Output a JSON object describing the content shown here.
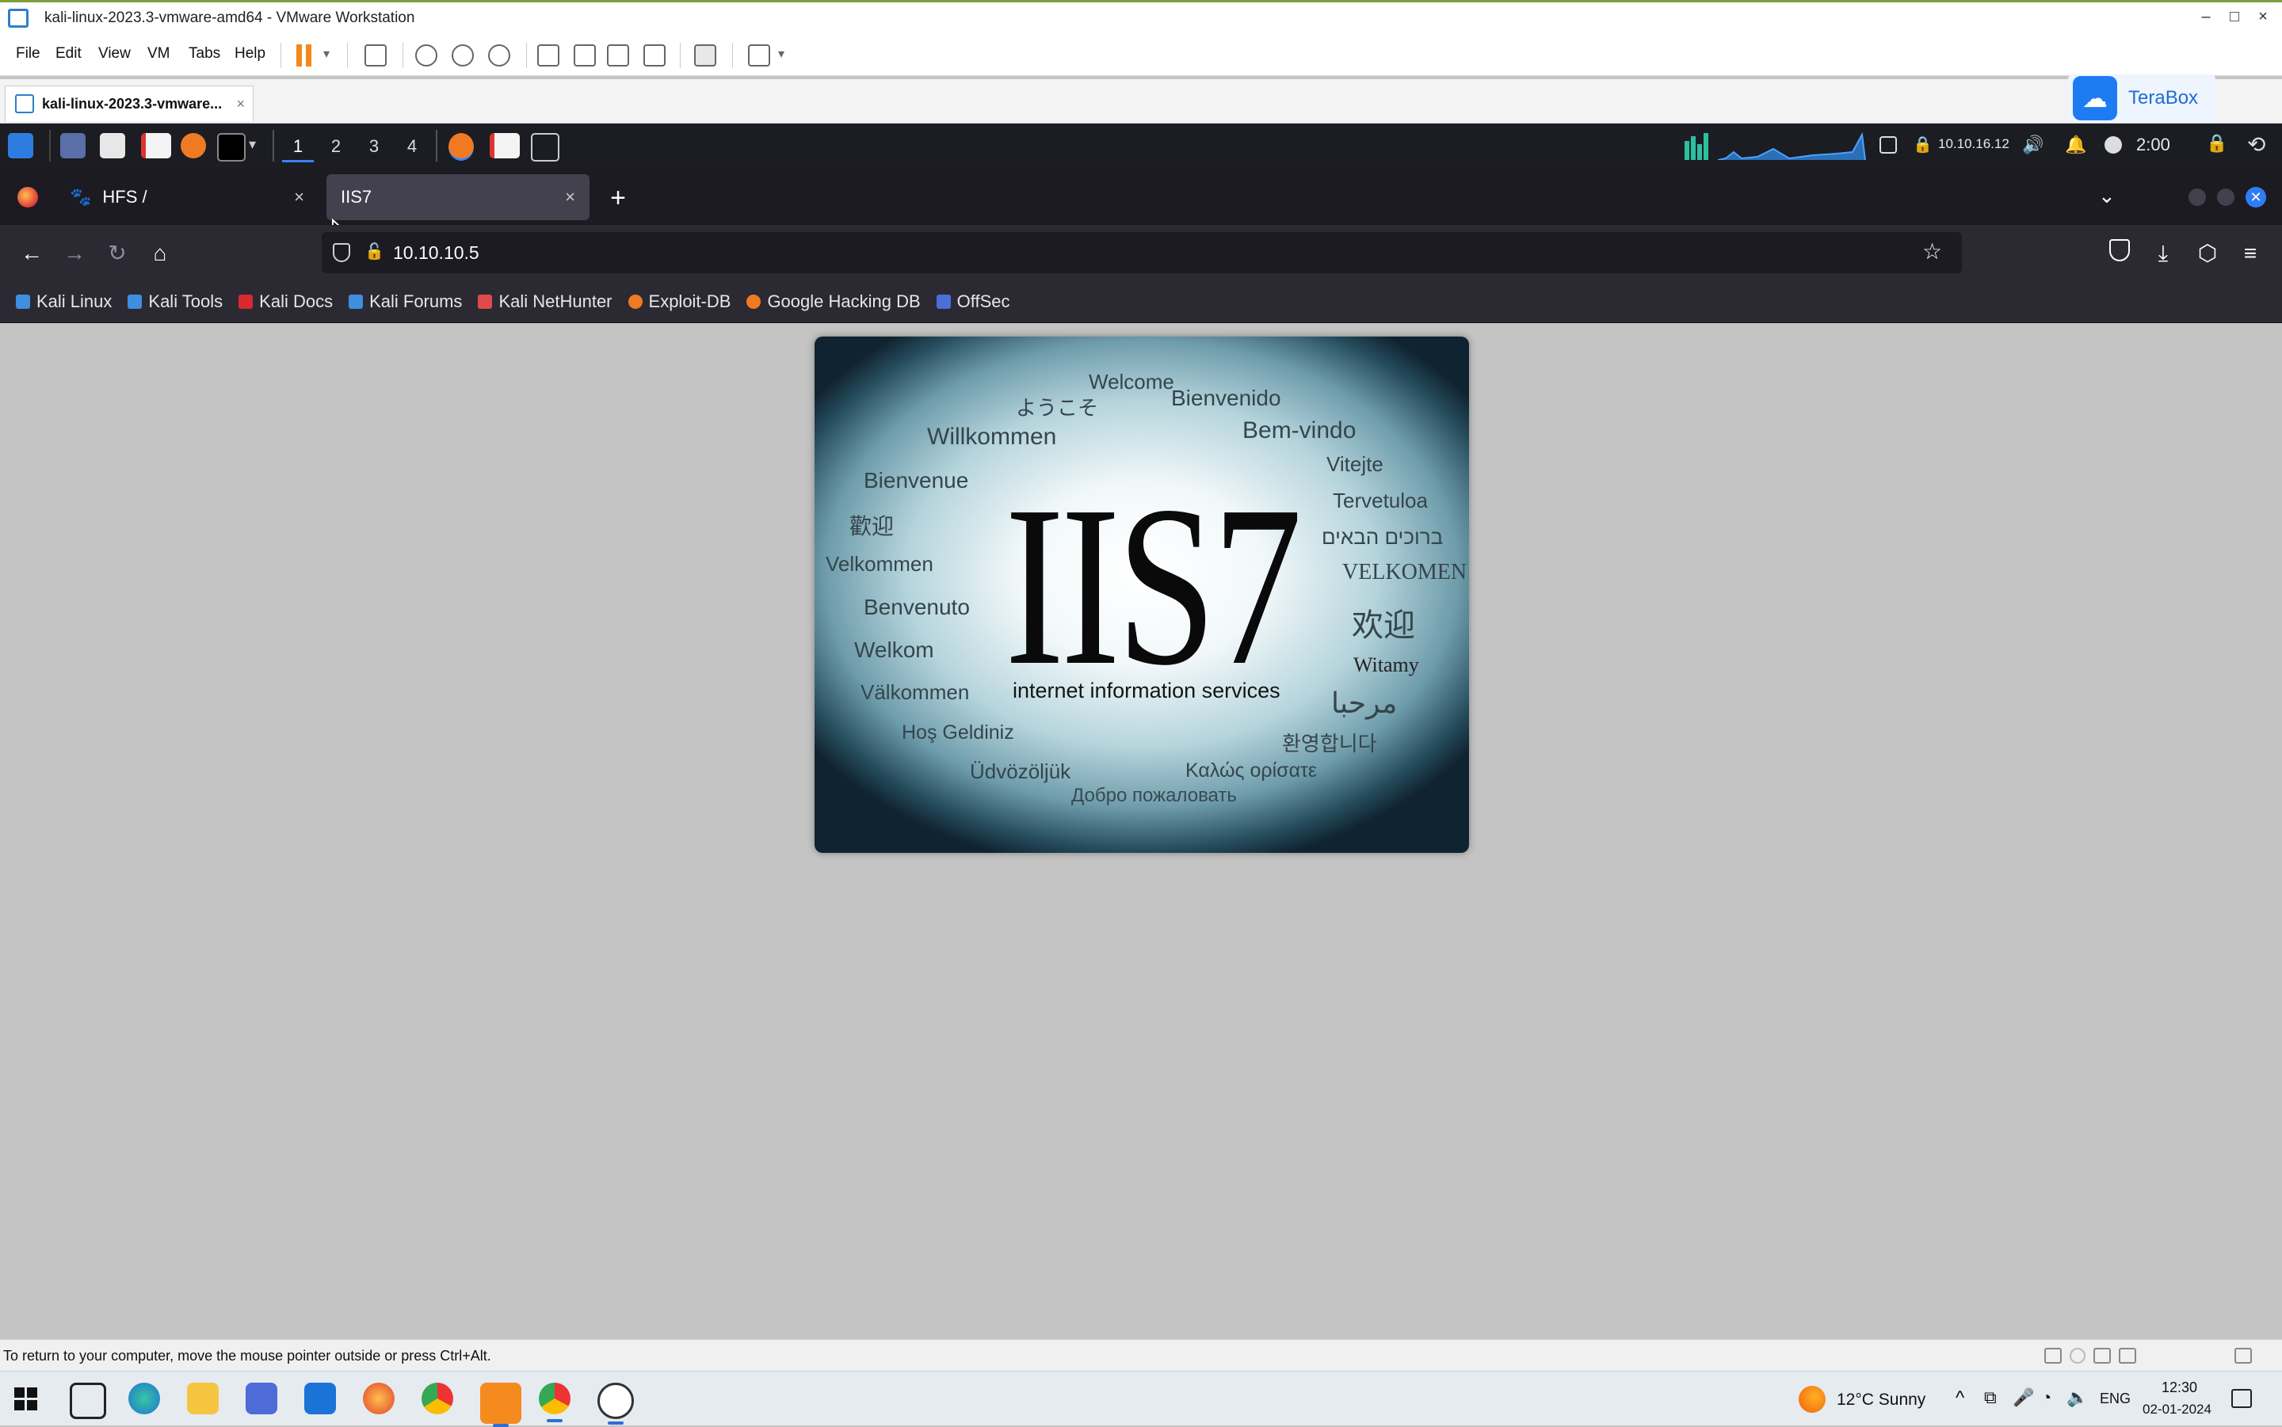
{
  "vmware": {
    "window_title": "kali-linux-2023.3-vmware-amd64 - VMware Workstation",
    "window_controls": {
      "minimize": "–",
      "maximize": "□",
      "close": "×"
    },
    "menu": [
      "File",
      "Edit",
      "View",
      "VM",
      "Tabs",
      "Help"
    ],
    "vm_tab": {
      "label": "kali-linux-2023.3-vmware...",
      "close": "×"
    },
    "terabox_label": "TeraBox",
    "status_message": "To return to your computer, move the mouse pointer outside or press Ctrl+Alt."
  },
  "kali_panel": {
    "workspaces": [
      "1",
      "2",
      "3",
      "4"
    ],
    "active_workspace": "1",
    "network_ip": "10.10.16.12",
    "clock": "2:00"
  },
  "firefox": {
    "tabs": [
      {
        "title": "HFS /",
        "close": "×",
        "active": false
      },
      {
        "title": "IIS7",
        "close": "×",
        "active": true
      }
    ],
    "new_tab": "+",
    "url": "10.10.10.5",
    "bookmarks": [
      "Kali Linux",
      "Kali Tools",
      "Kali Docs",
      "Kali Forums",
      "Kali NetHunter",
      "Exploit-DB",
      "Google Hacking DB",
      "OffSec"
    ]
  },
  "page": {
    "logo": "IIS7",
    "subtitle": "internet information services",
    "welcome_words": {
      "w01": "Welcome",
      "w02": "ようこそ",
      "w03": "Bienvenido",
      "w04": "Willkommen",
      "w05": "Bem-vindo",
      "w06": "Bienvenue",
      "w07": "Vitejte",
      "w08": "Tervetuloa",
      "w09": "歡迎",
      "w10": "ברוכים הבאים",
      "w11": "Velkommen",
      "w12": "VELKOMEN",
      "w13": "Benvenuto",
      "w14": "欢迎",
      "w15": "Welkom",
      "w16": "Witamy",
      "w17": "Välkommen",
      "w18": "مرحبا",
      "w19": "Hoş Geldiniz",
      "w20": "환영합니다",
      "w21": "Üdvözöljük",
      "w22": "Καλώς ορίσατε",
      "w23": "Добро пожаловать"
    }
  },
  "taskbar": {
    "weather": "12°C  Sunny",
    "language": "ENG",
    "time": "12:30",
    "date": "02-01-2024"
  },
  "colors": {
    "firefox_dark": "#1c1b22",
    "firefox_toolbar": "#2b2a33",
    "active_tab": "#42414d",
    "kali_panel": "#1b1d22",
    "accent_blue": "#3b82f6",
    "content_bg": "#c4c4c4"
  }
}
